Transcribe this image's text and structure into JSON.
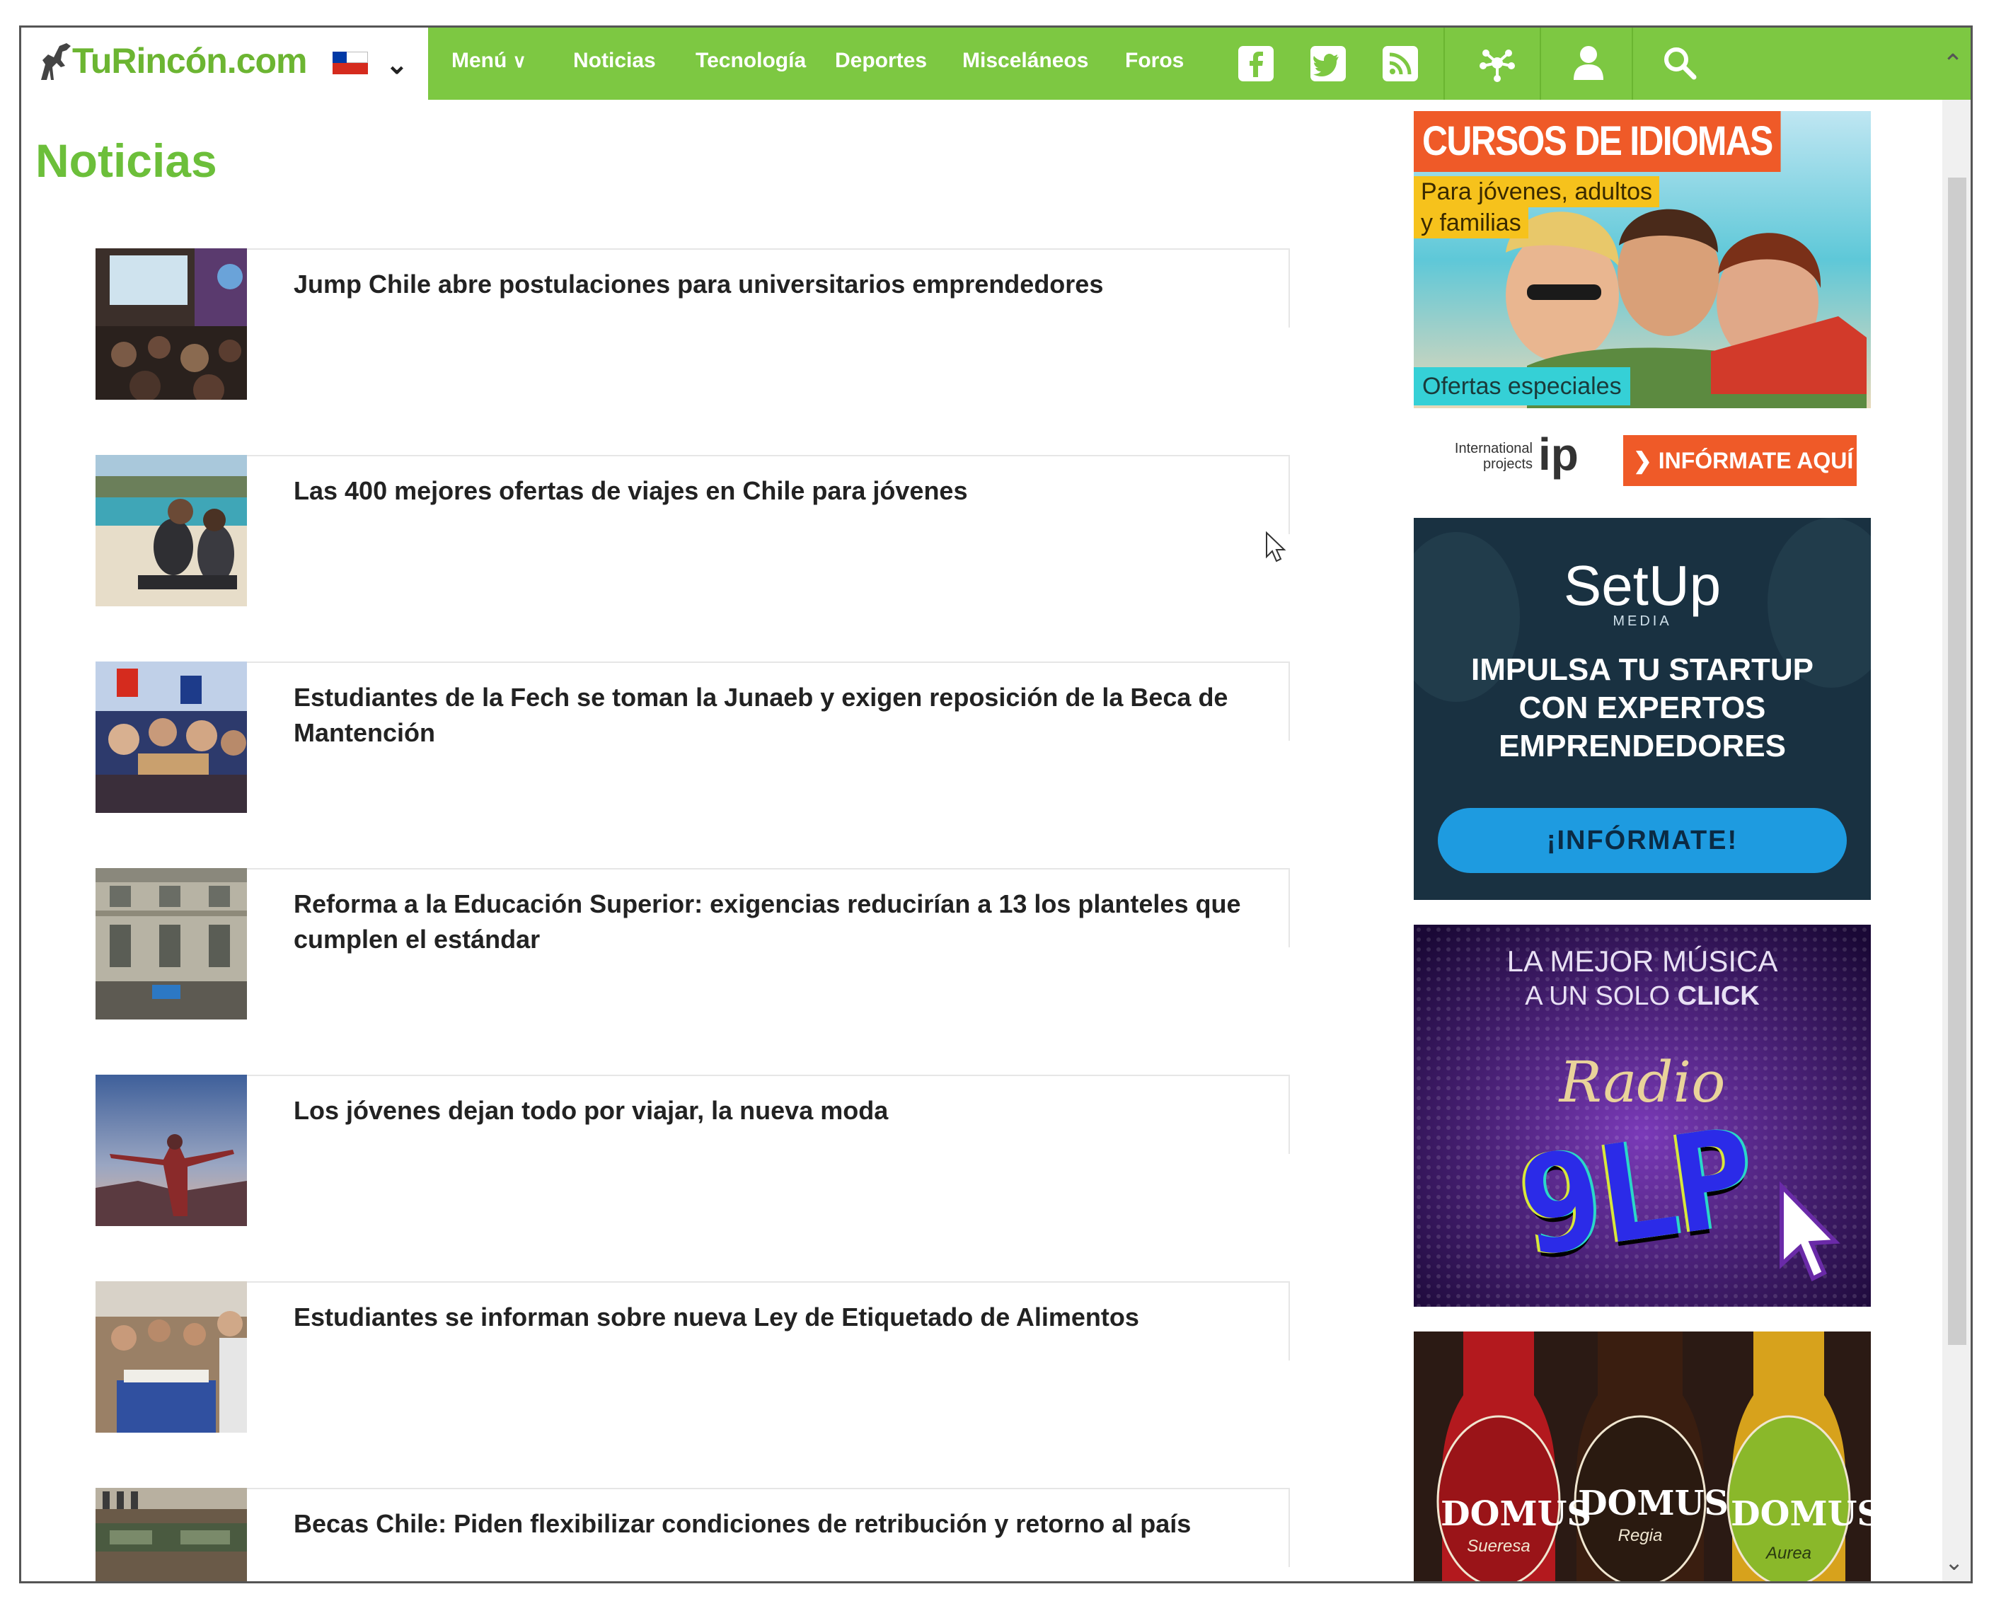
{
  "site": {
    "logo_text": "TuRincón.com",
    "country_flag": "chile-flag-icon"
  },
  "nav": {
    "menu_label": "Menú",
    "items": [
      "Noticias",
      "Tecnología",
      "Deportes",
      "Misceláneos",
      "Foros"
    ],
    "icons": [
      "facebook-icon",
      "twitter-icon",
      "rss-icon",
      "network-icon",
      "user-icon",
      "search-icon"
    ]
  },
  "page": {
    "title": "Noticias"
  },
  "articles": [
    {
      "headline": "Jump Chile abre postulaciones para universitarios emprendedores"
    },
    {
      "headline": "Las 400 mejores ofertas de viajes en Chile para jóvenes"
    },
    {
      "headline": "Estudiantes de la Fech se toman la Junaeb y exigen reposición de la Beca de Mantención"
    },
    {
      "headline": "Reforma a la Educación Superior: exigencias reducirían a 13 los planteles que cumplen el estándar"
    },
    {
      "headline": "Los jóvenes dejan todo por viajar, la nueva moda"
    },
    {
      "headline": "Estudiantes se informan sobre nueva Ley de Etiquetado de Alimentos"
    },
    {
      "headline": "Becas Chile: Piden flexibilizar condiciones de retribución y retorno al país"
    }
  ],
  "ads": {
    "idiomas": {
      "title": "CURSOS DE IDIOMAS",
      "subtitle_1": "Para jóvenes, adultos",
      "subtitle_2": "y familias",
      "offer": "Ofertas especiales",
      "brand_1": "International",
      "brand_2": "projects",
      "brand_logo": "ip",
      "cta": "INFÓRMATE AQUÍ"
    },
    "setup": {
      "logo": "SetUp",
      "logo_sub": "MEDIA",
      "line_1": "IMPULSA TU STARTUP",
      "line_2": "CON EXPERTOS",
      "line_3": "EMPRENDEDORES",
      "cta": "¡INFÓRMATE!"
    },
    "radio": {
      "line_1": "LA MEJOR MÚSICA",
      "line_2a": "A UN SOLO ",
      "line_2b": "CLICK",
      "script": "Radio",
      "logo": "9LP"
    },
    "domus": {
      "brand": "DOMUS",
      "variants": [
        "Sueresa",
        "Regia",
        "Aurea"
      ]
    }
  },
  "colors": {
    "nav_green": "#7dc842",
    "title_green": "#6cbf3a",
    "headline": "#222222",
    "ad_orange": "#ef5a28",
    "ad_yellow": "#f6c21c",
    "ad_cyan": "#35d0d6",
    "setup_blue": "#1e9be0"
  }
}
